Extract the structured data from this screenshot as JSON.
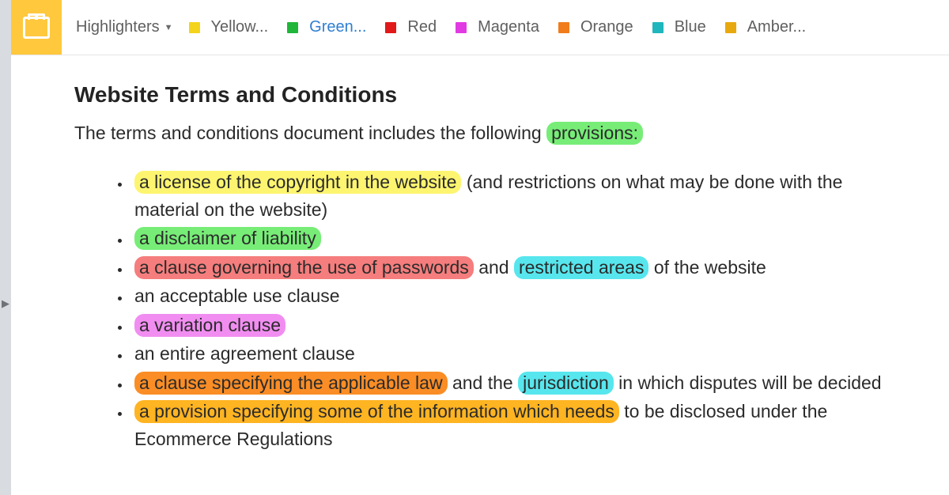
{
  "toolbar": {
    "group_label": "Highlighters",
    "highlighters": [
      {
        "label": "Yellow...",
        "swatch": "#f3d41a",
        "selected": false
      },
      {
        "label": "Green...",
        "swatch": "#1fb63a",
        "selected": true
      },
      {
        "label": "Red",
        "swatch": "#e11919",
        "selected": false
      },
      {
        "label": "Magenta",
        "swatch": "#e23ae2",
        "selected": false
      },
      {
        "label": "Orange",
        "swatch": "#f07d1a",
        "selected": false
      },
      {
        "label": "Blue",
        "swatch": "#1fb6bd",
        "selected": false
      },
      {
        "label": "Amber...",
        "swatch": "#e8a90f",
        "selected": false
      }
    ]
  },
  "document": {
    "title": "Website Terms and Conditions",
    "lead_pre": "The terms and conditions document includes the following ",
    "lead_hl": "provisions:",
    "lead_hl_class": "hl-green",
    "items": [
      {
        "runs": [
          {
            "text": "a license of the copyright in the website",
            "hl": "hl-yellow"
          },
          {
            "text": " (and restrictions on what may be done with the material on the website)"
          }
        ]
      },
      {
        "runs": [
          {
            "text": "a disclaimer of liability",
            "hl": "hl-green"
          }
        ]
      },
      {
        "runs": [
          {
            "text": "a clause governing the use of passwords",
            "hl": "hl-red"
          },
          {
            "text": " and "
          },
          {
            "text": "restricted areas",
            "hl": "hl-blue"
          },
          {
            "text": " of the website"
          }
        ]
      },
      {
        "runs": [
          {
            "text": "an acceptable use clause"
          }
        ]
      },
      {
        "runs": [
          {
            "text": "a variation clause",
            "hl": "hl-magenta"
          }
        ]
      },
      {
        "runs": [
          {
            "text": "an entire agreement clause"
          }
        ]
      },
      {
        "runs": [
          {
            "text": "a clause specifying the applicable law",
            "hl": "hl-orange"
          },
          {
            "text": " and the "
          },
          {
            "text": "jurisdiction",
            "hl": "hl-blue"
          },
          {
            "text": " in which disputes will be decided"
          }
        ]
      },
      {
        "runs": [
          {
            "text": "a provision specifying some of the information which needs",
            "hl": "hl-amber"
          },
          {
            "text": " to be disclosed under the Ecommerce Regulations"
          }
        ]
      }
    ]
  }
}
